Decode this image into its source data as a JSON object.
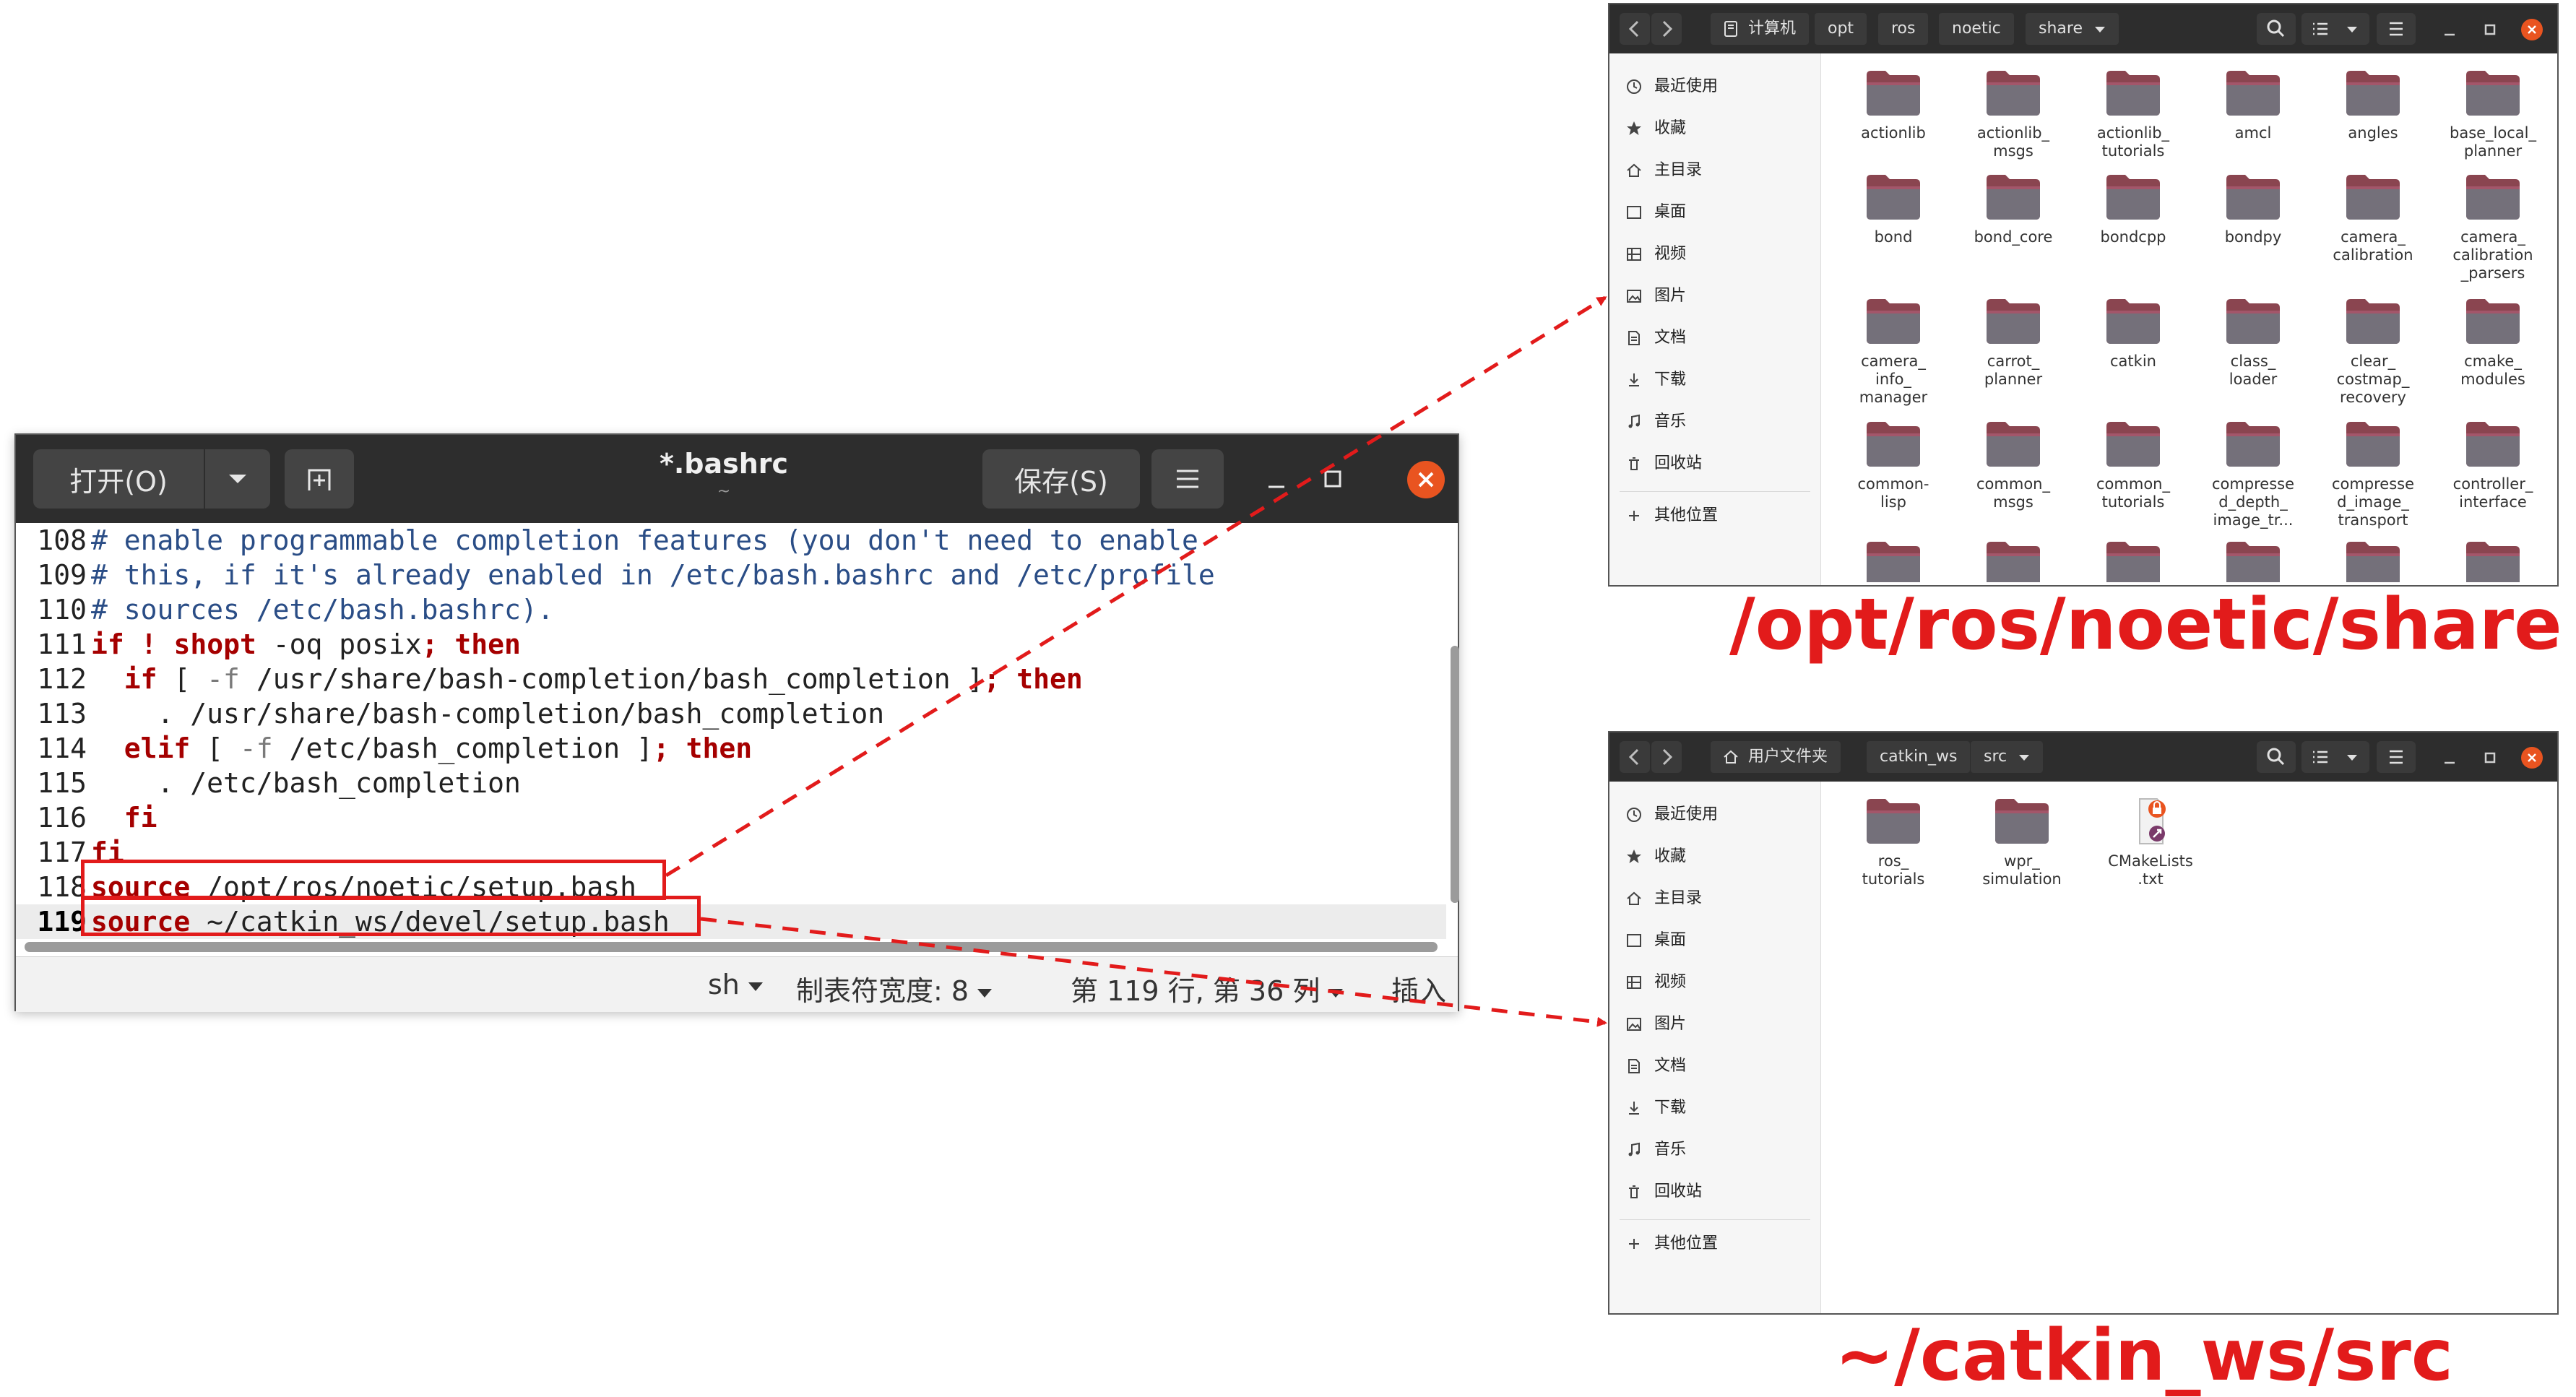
{
  "colors": {
    "accent_red": "#e21b1b",
    "ubuntu_orange": "#e95420",
    "header_dark": "#2d2d2d",
    "folder": "#7a3a44"
  },
  "editor": {
    "open_label": "打开(O)",
    "save_label": "保存(S)",
    "title": "*.bashrc",
    "subtitle": "~",
    "lines": [
      {
        "n": "108",
        "parts": [
          [
            "c-cm",
            "# enable programmable completion features (you don't need to enable"
          ]
        ]
      },
      {
        "n": "109",
        "parts": [
          [
            "c-cm",
            "# this, if it's already enabled in /etc/bash.bashrc and /etc/profile"
          ]
        ]
      },
      {
        "n": "110",
        "parts": [
          [
            "c-cm",
            "# sources /etc/bash.bashrc)."
          ]
        ]
      },
      {
        "n": "111",
        "parts": [
          [
            "c-kw",
            "if"
          ],
          [
            "c-tx",
            " "
          ],
          [
            "c-kw",
            "!"
          ],
          [
            "c-tx",
            " "
          ],
          [
            "c-kw",
            "shopt"
          ],
          [
            "c-tx",
            " -oq posix"
          ],
          [
            "c-kw",
            "; then"
          ]
        ]
      },
      {
        "n": "112",
        "parts": [
          [
            "c-tx",
            "  "
          ],
          [
            "c-kw",
            "if"
          ],
          [
            "c-tx",
            " [ "
          ],
          [
            "c-op",
            "-f"
          ],
          [
            "c-tx",
            " /usr/share/bash-completion/bash_completion ]"
          ],
          [
            "c-kw",
            "; then"
          ]
        ]
      },
      {
        "n": "113",
        "parts": [
          [
            "c-tx",
            "    . /usr/share/bash-completion/bash_completion"
          ]
        ]
      },
      {
        "n": "114",
        "parts": [
          [
            "c-tx",
            "  "
          ],
          [
            "c-kw",
            "elif"
          ],
          [
            "c-tx",
            " [ "
          ],
          [
            "c-op",
            "-f"
          ],
          [
            "c-tx",
            " /etc/bash_completion ]"
          ],
          [
            "c-kw",
            "; then"
          ]
        ]
      },
      {
        "n": "115",
        "parts": [
          [
            "c-tx",
            "    . /etc/bash_completion"
          ]
        ]
      },
      {
        "n": "116",
        "parts": [
          [
            "c-tx",
            "  "
          ],
          [
            "c-kw",
            "fi"
          ]
        ]
      },
      {
        "n": "117",
        "parts": [
          [
            "c-kw",
            "fi"
          ]
        ]
      },
      {
        "n": "118",
        "parts": [
          [
            "c-kw",
            "source"
          ],
          [
            "c-tx",
            " /opt/ros/noetic/setup.bash"
          ]
        ]
      },
      {
        "n": "119",
        "parts": [
          [
            "c-kw",
            "source"
          ],
          [
            "c-tx",
            " ~/catkin_ws/devel/setup.bash"
          ]
        ]
      }
    ],
    "status": {
      "lang": "sh",
      "tab_width": "制表符宽度: 8",
      "position": "第 119 行, 第 36 列",
      "mode": "插入"
    }
  },
  "fm1": {
    "crumbs": [
      "计算机",
      "opt",
      "ros",
      "noetic",
      "share"
    ],
    "sidebar": [
      "最近使用",
      "收藏",
      "主目录",
      "桌面",
      "视频",
      "图片",
      "文档",
      "下载",
      "音乐",
      "回收站"
    ],
    "other_places": "其他位置",
    "items": [
      "actionlib",
      "actionlib_\nmsgs",
      "actionlib_\ntutorials",
      "amcl",
      "angles",
      "base_local_\nplanner",
      "bond",
      "bond_core",
      "bondcpp",
      "bondpy",
      "camera_\ncalibration",
      "camera_\ncalibration\n_parsers",
      "camera_\ninfo_\nmanager",
      "carrot_\nplanner",
      "catkin",
      "class_\nloader",
      "clear_\ncostmap_\nrecovery",
      "cmake_\nmodules",
      "common-\nlisp",
      "common_\nmsgs",
      "common_\ntutorials",
      "compresse\nd_depth_\nimage_tr...",
      "compresse\nd_image_\ntransport",
      "controller_\ninterface",
      "",
      "",
      "",
      "",
      "",
      ""
    ]
  },
  "fm2": {
    "crumbs": [
      "用户文件夹",
      "catkin_ws",
      "src"
    ],
    "sidebar": [
      "最近使用",
      "收藏",
      "主目录",
      "桌面",
      "视频",
      "图片",
      "文档",
      "下载",
      "音乐",
      "回收站"
    ],
    "other_places": "其他位置",
    "items": [
      "ros_\ntutorials",
      "wpr_\nsimulation",
      "CMakeLists\n.txt"
    ]
  },
  "captions": {
    "share_path": "/opt/ros/noetic/share",
    "src_path": "~/catkin_ws/src"
  }
}
